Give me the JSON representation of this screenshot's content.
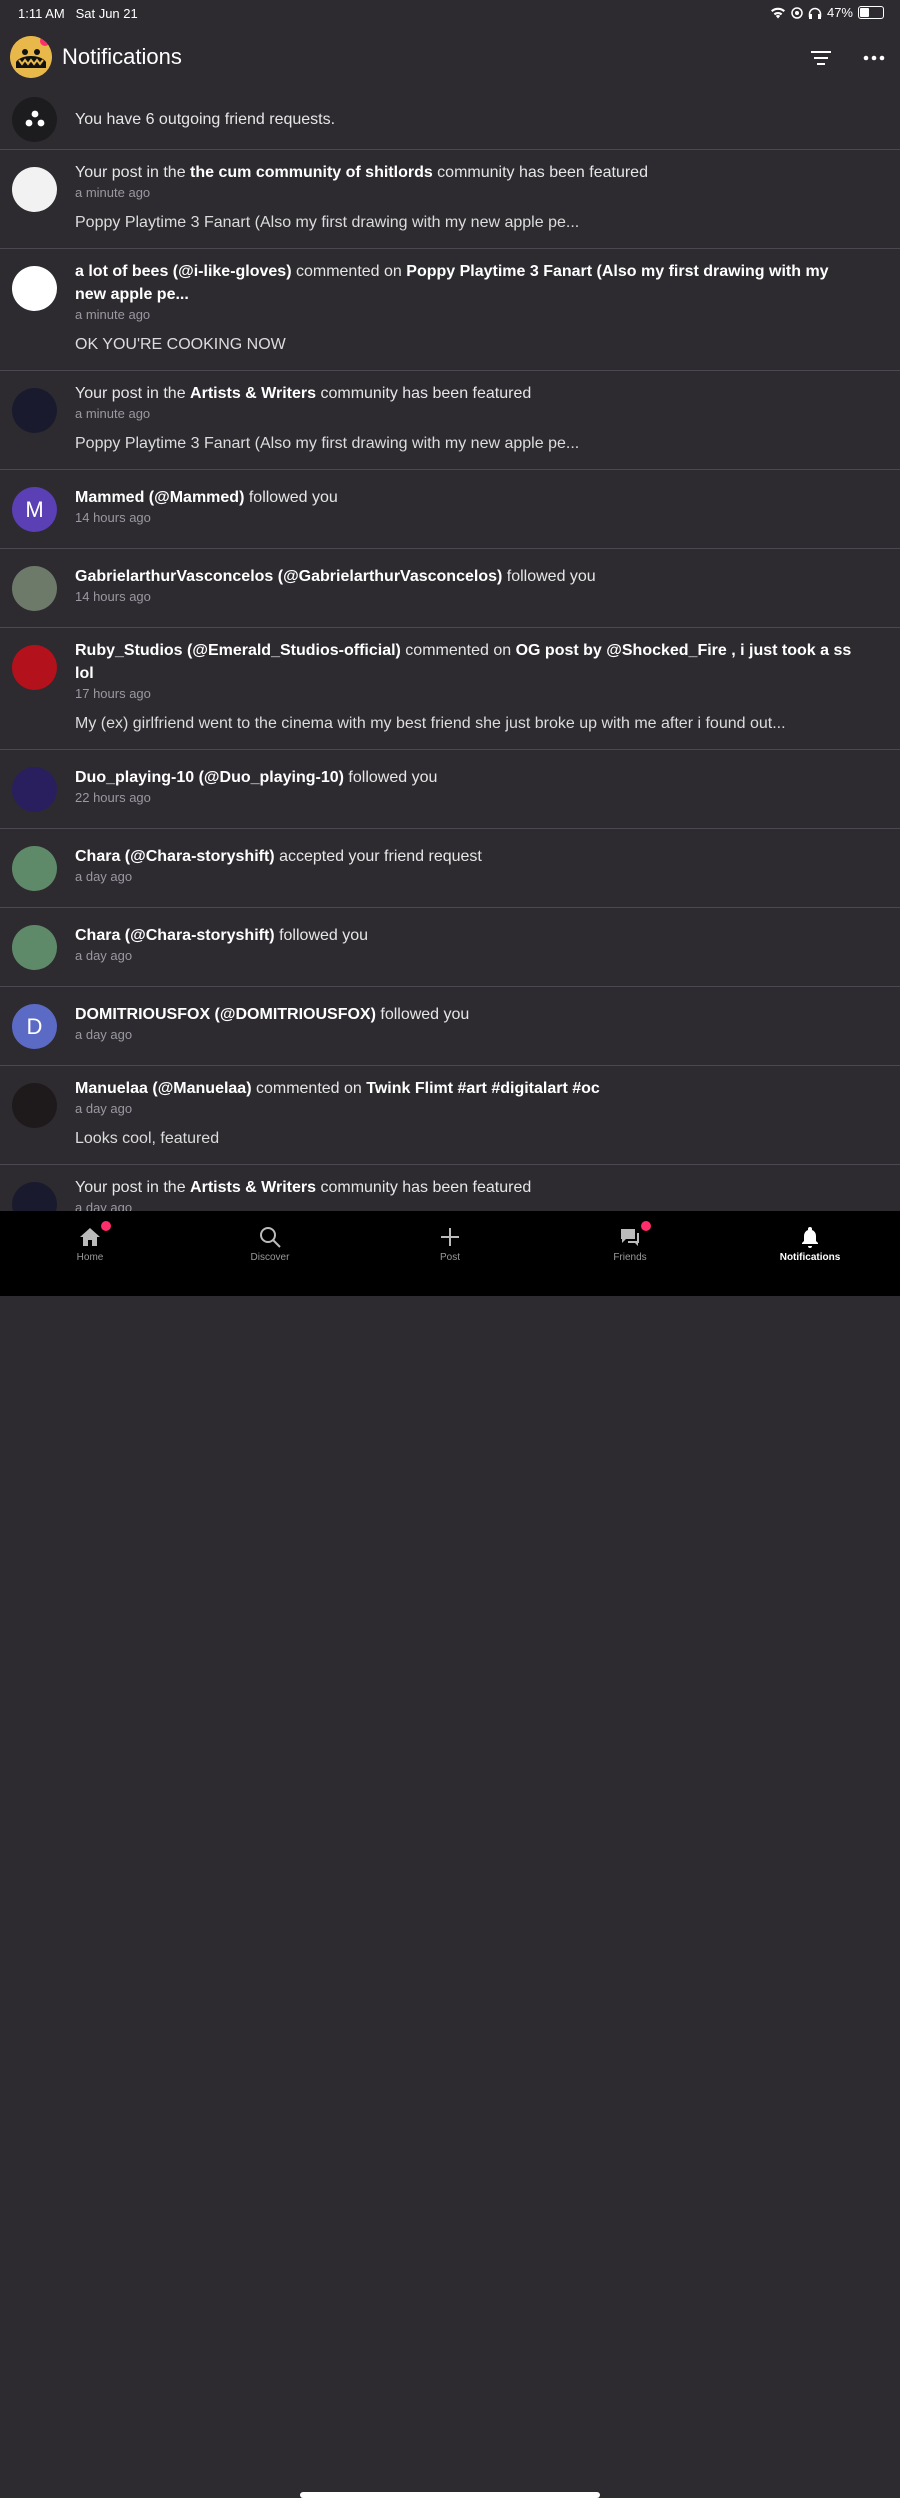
{
  "status": {
    "time": "1:11 AM",
    "date": "Sat Jun 21",
    "battery": "47%",
    "battery_level": 0.47
  },
  "header": {
    "title": "Notifications"
  },
  "outgoing": {
    "text": "You have 6 outgoing friend requests."
  },
  "notifications": [
    {
      "type": "community",
      "pre": "Your post in the ",
      "bold": "the cum community of shitlords",
      "post": " community has been featured",
      "time": "a minute ago",
      "preview": "Poppy Playtime 3 Fanart (Also my first drawing with my new apple pe...",
      "avatar_color": "#f2f2f2"
    },
    {
      "type": "comment",
      "user": "a lot of bees (@i-like-gloves)",
      "action": " commented on ",
      "target": "Poppy Playtime 3 Fanart (Also my first drawing with my new apple pe...",
      "time": "a minute ago",
      "preview": "OK YOU'RE COOKING NOW",
      "avatar_color": "#ffffff"
    },
    {
      "type": "community",
      "pre": "Your post in the ",
      "bold": "Artists & Writers",
      "post": " community has been featured",
      "time": "a minute ago",
      "preview": "Poppy Playtime 3 Fanart (Also my first drawing with my new apple pe...",
      "avatar_color": "#1a1a2e"
    },
    {
      "type": "follow",
      "user": "Mammed (@Mammed)",
      "action": " followed you",
      "time": "14 hours ago",
      "letter": "M",
      "avatar_color": "#5b3fb5"
    },
    {
      "type": "follow",
      "user": "GabrielarthurVasconcelos (@GabrielarthurVasconcelos)",
      "action": " followed you",
      "time": "14 hours ago",
      "avatar_color": "#6d7a6a"
    },
    {
      "type": "comment",
      "user": "Ruby_Studios (@Emerald_Studios-official)",
      "action": " commented on ",
      "target": "OG post by @Shocked_Fire , i just took a ss lol",
      "time": "17 hours ago",
      "preview": "My (ex) girlfriend went to the cinema with my best friend she just broke up with me after i found out...",
      "avatar_color": "#b3121c"
    },
    {
      "type": "follow",
      "user": "Duo_playing-10 (@Duo_playing-10)",
      "action": " followed you",
      "time": "22 hours ago",
      "avatar_color": "#2a1f5e"
    },
    {
      "type": "follow",
      "user": "Chara (@Chara-storyshift)",
      "action": " accepted your friend request",
      "time": "a day ago",
      "avatar_color": "#5f8a6a"
    },
    {
      "type": "follow",
      "user": "Chara (@Chara-storyshift)",
      "action": " followed you",
      "time": "a day ago",
      "avatar_color": "#5f8a6a"
    },
    {
      "type": "follow",
      "user": "DOMITRIOUSFOX (@DOMITRIOUSFOX)",
      "action": " followed you",
      "time": "a day ago",
      "letter": "D",
      "avatar_color": "#5b6ac4"
    },
    {
      "type": "comment",
      "user": "Manuelaa (@Manuelaa)",
      "action": " commented on ",
      "target": "Twink Flimt #art #digitalart #oc",
      "time": "a day ago",
      "preview": "Looks cool, featured",
      "avatar_color": "#1e1a1c"
    },
    {
      "type": "community",
      "pre": "Your post in the ",
      "bold": "Artists & Writers",
      "post": " community has been featured",
      "time": "a day ago",
      "avatar_color": "#1a1a2e"
    }
  ],
  "tabs": [
    {
      "label": "Home",
      "icon": "home-icon",
      "badge": true
    },
    {
      "label": "Discover",
      "icon": "search-icon",
      "badge": false
    },
    {
      "label": "Post",
      "icon": "plus-icon",
      "badge": false
    },
    {
      "label": "Friends",
      "icon": "chat-bubbles-icon",
      "badge": true
    },
    {
      "label": "Notifications",
      "icon": "bell-icon",
      "badge": false,
      "active": true
    }
  ],
  "colors": {
    "background": "#2d2b30",
    "badge": "#ff2d6a",
    "tabbar": "#000000"
  }
}
